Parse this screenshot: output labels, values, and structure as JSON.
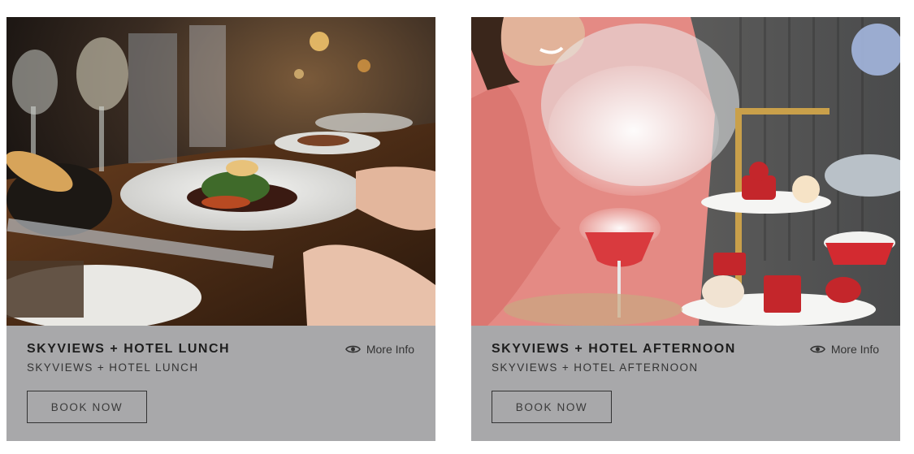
{
  "cards": [
    {
      "title": "SKYVIEWS + HOTEL LUNCH",
      "subtitle": "SKYVIEWS + HOTEL LUNCH",
      "more_info_label": "More Info",
      "more_info_icon": "eye-icon",
      "book_label": "BOOK NOW",
      "image_description_icon": "lunch-dining-photo"
    },
    {
      "title": "SKYVIEWS + HOTEL AFTERNOON",
      "subtitle": "SKYVIEWS + HOTEL AFTERNOON",
      "more_info_label": "More Info",
      "more_info_icon": "eye-icon",
      "book_label": "BOOK NOW",
      "image_description_icon": "afternoon-tea-photo"
    }
  ],
  "colors": {
    "card_background": "#a8a8aa",
    "text_dark": "#1e1e1e",
    "button_border": "#333333"
  }
}
